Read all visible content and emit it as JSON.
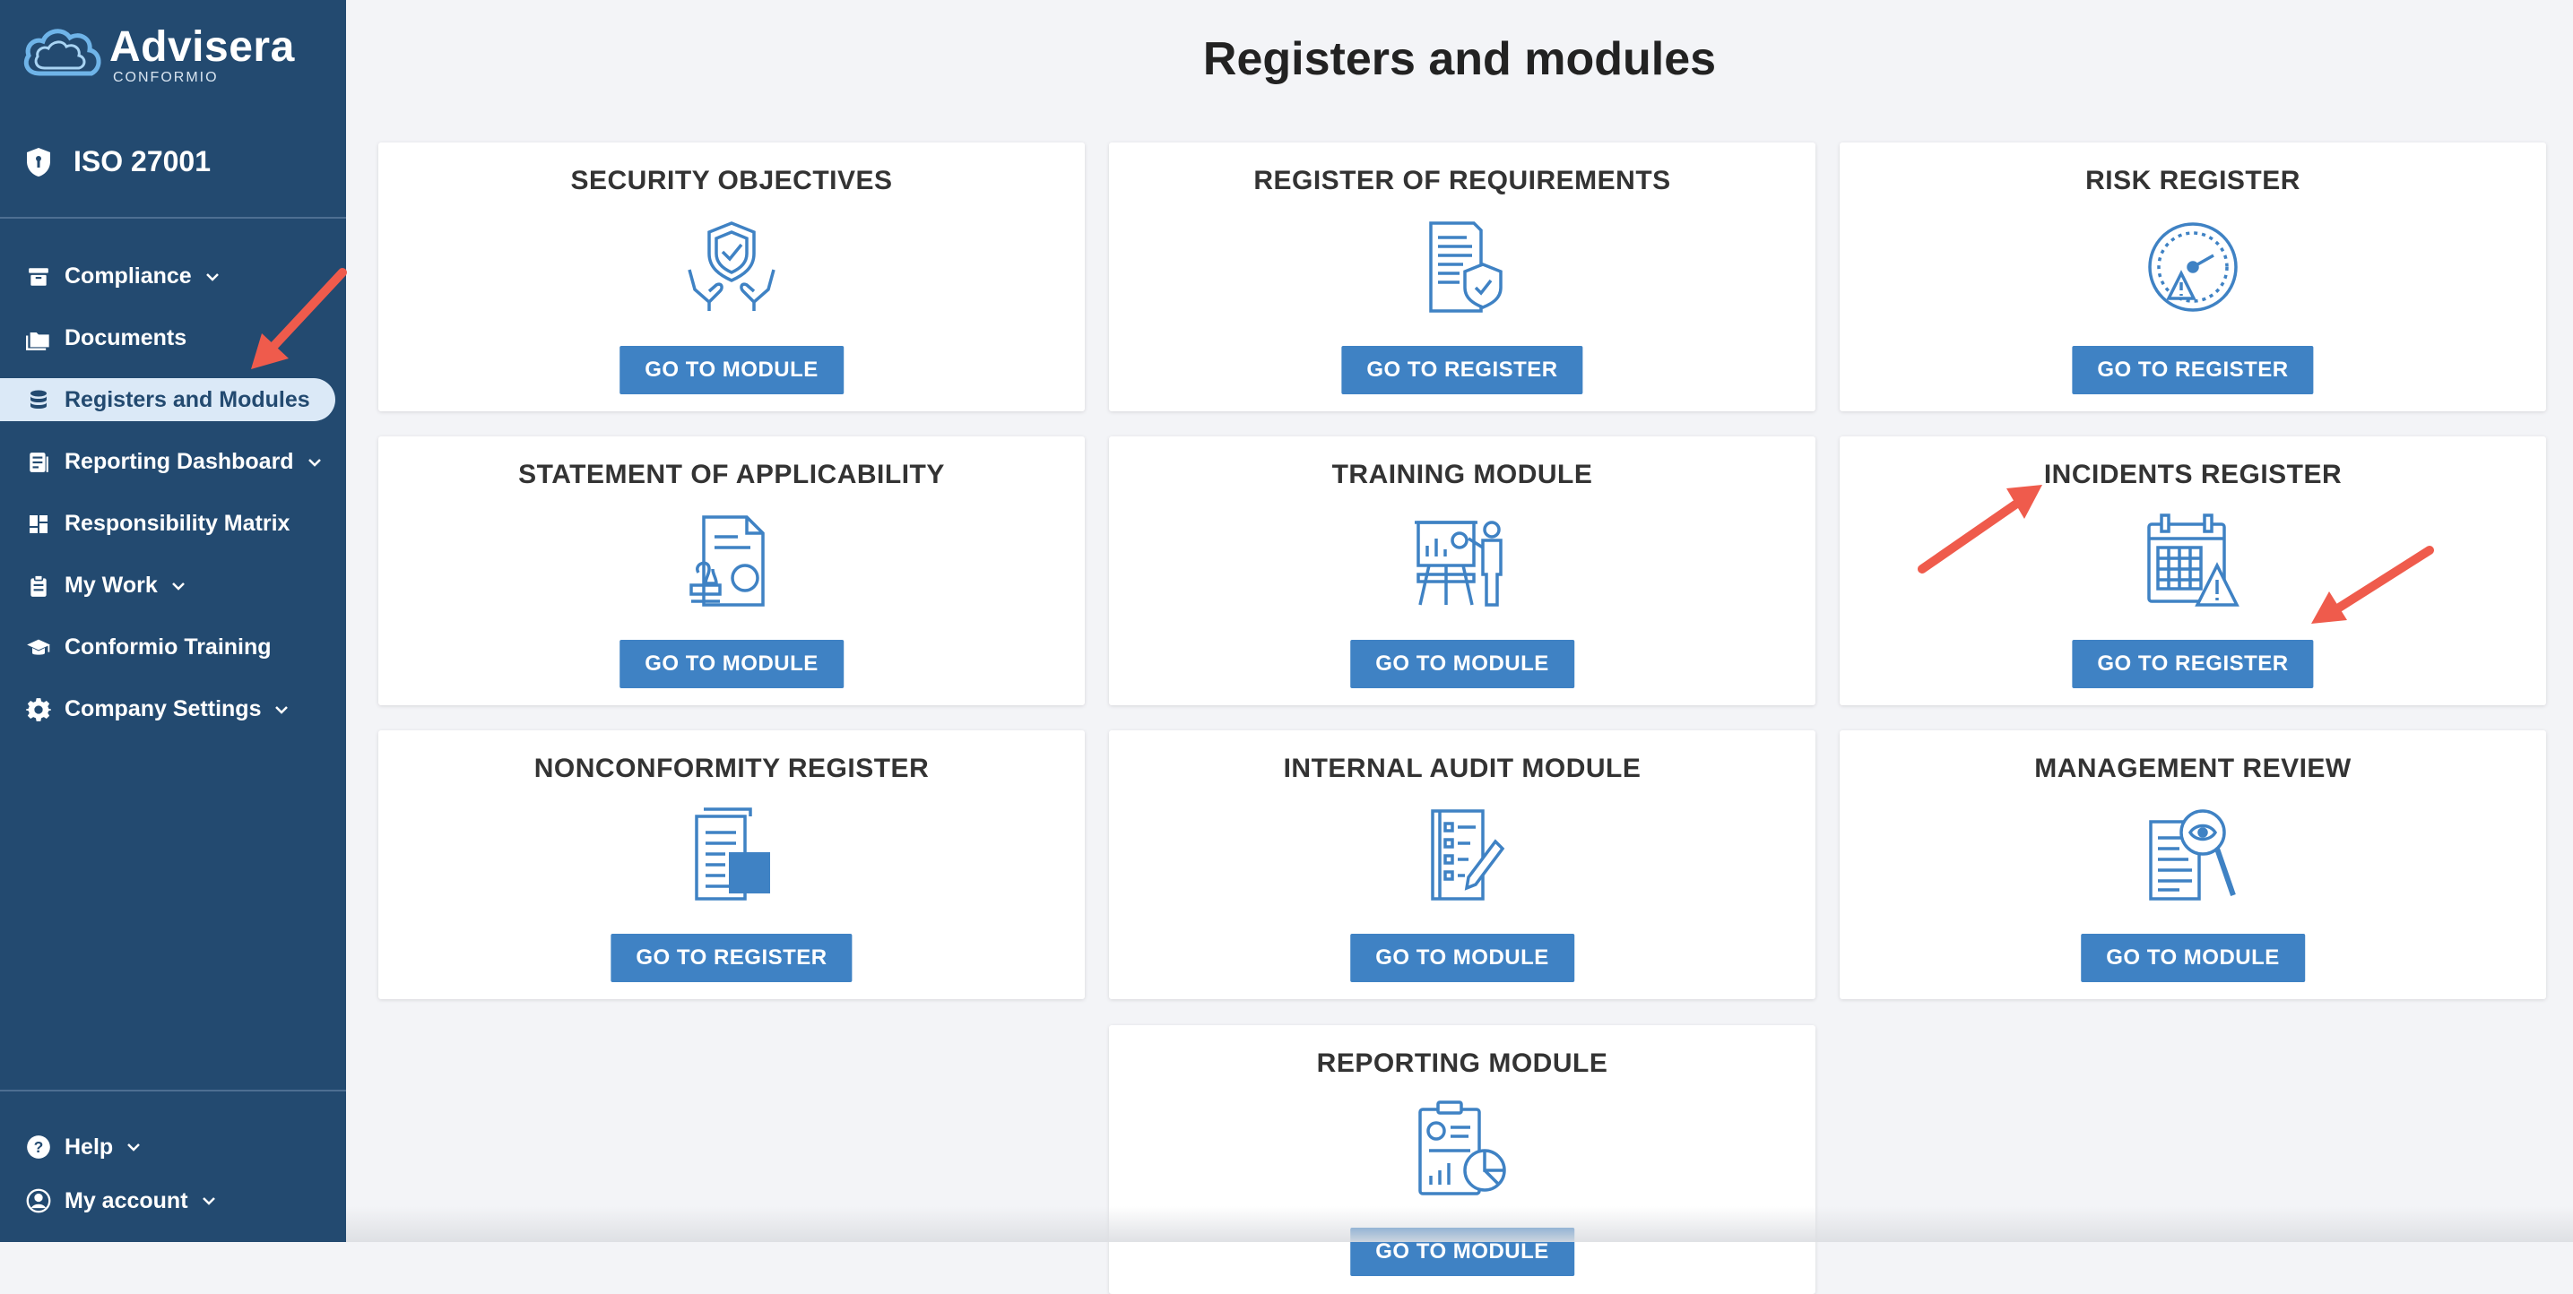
{
  "brand": {
    "name": "Advisera",
    "sub": "CONFORMIO"
  },
  "product": "ISO 27001",
  "nav": [
    {
      "label": "Compliance",
      "icon": "archive-icon",
      "chevron": true
    },
    {
      "label": "Documents",
      "icon": "folder-icon",
      "chevron": false
    },
    {
      "label": "Registers and Modules",
      "icon": "database-icon",
      "chevron": false,
      "active": true
    },
    {
      "label": "Reporting Dashboard",
      "icon": "report-icon",
      "chevron": true
    },
    {
      "label": "Responsibility Matrix",
      "icon": "grid-icon",
      "chevron": false
    },
    {
      "label": "My Work",
      "icon": "clipboard-icon",
      "chevron": true
    },
    {
      "label": "Conformio Training",
      "icon": "graduation-cap-icon",
      "chevron": false
    },
    {
      "label": "Company Settings",
      "icon": "gear-icon",
      "chevron": true
    }
  ],
  "bottom_nav": [
    {
      "label": "Help",
      "icon": "help-icon"
    },
    {
      "label": "My account",
      "icon": "user-icon"
    }
  ],
  "page_title": "Registers and modules",
  "cards": [
    {
      "title": "SECURITY OBJECTIVES",
      "button": "GO TO MODULE",
      "icon": "shield-hands-icon"
    },
    {
      "title": "REGISTER OF REQUIREMENTS",
      "button": "GO TO REGISTER",
      "icon": "document-shield-icon"
    },
    {
      "title": "RISK REGISTER",
      "button": "GO TO REGISTER",
      "icon": "risk-gauge-icon"
    },
    {
      "title": "STATEMENT OF APPLICABILITY",
      "button": "GO TO MODULE",
      "icon": "document-stamp-icon"
    },
    {
      "title": "TRAINING MODULE",
      "button": "GO TO MODULE",
      "icon": "presentation-icon"
    },
    {
      "title": "INCIDENTS REGISTER",
      "button": "GO TO REGISTER",
      "icon": "calendar-warning-icon"
    },
    {
      "title": "NONCONFORMITY REGISTER",
      "button": "GO TO REGISTER",
      "icon": "document-square-icon"
    },
    {
      "title": "INTERNAL AUDIT MODULE",
      "button": "GO TO MODULE",
      "icon": "checklist-pen-icon"
    },
    {
      "title": "MANAGEMENT REVIEW",
      "button": "GO TO MODULE",
      "icon": "document-magnifier-icon"
    },
    {
      "title": "REPORTING MODULE",
      "button": "GO TO MODULE",
      "icon": "report-chart-icon"
    }
  ],
  "colors": {
    "sidebar": "#234a70",
    "accent": "#3f82c4",
    "annotation": "#ef5b4c"
  }
}
